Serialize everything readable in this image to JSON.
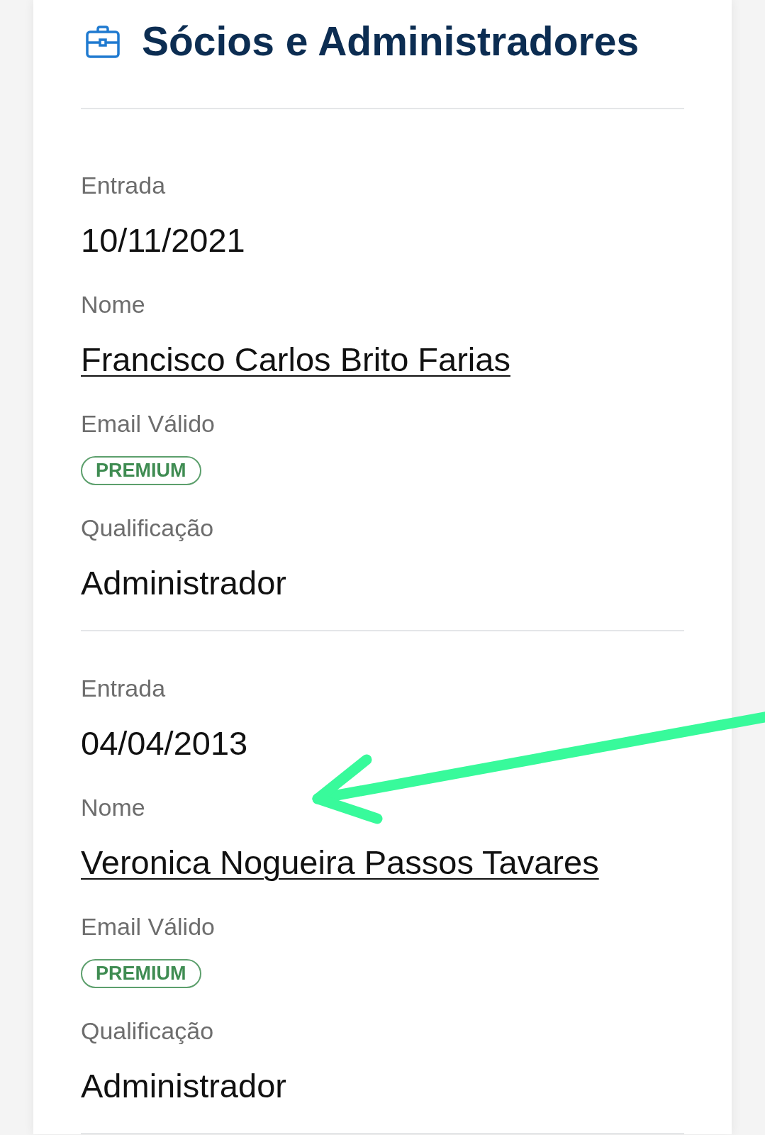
{
  "header": {
    "title": "Sócios e Administradores"
  },
  "partners": [
    {
      "fields": [
        {
          "kind": "text",
          "label": "Entrada",
          "value": "10/11/2021"
        },
        {
          "kind": "link",
          "label": "Nome",
          "value": "Francisco Carlos Brito Farias"
        },
        {
          "kind": "badge",
          "label": "Email Válido",
          "value": "PREMIUM"
        },
        {
          "kind": "text",
          "label": "Qualificação",
          "value": "Administrador"
        }
      ]
    },
    {
      "fields": [
        {
          "kind": "text",
          "label": "Entrada",
          "value": "04/04/2013"
        },
        {
          "kind": "link",
          "label": "Nome",
          "value": "Veronica Nogueira Passos Tavares"
        },
        {
          "kind": "badge",
          "label": "Email Válido",
          "value": "PREMIUM"
        },
        {
          "kind": "text",
          "label": "Qualificação",
          "value": "Administrador"
        }
      ]
    }
  ]
}
